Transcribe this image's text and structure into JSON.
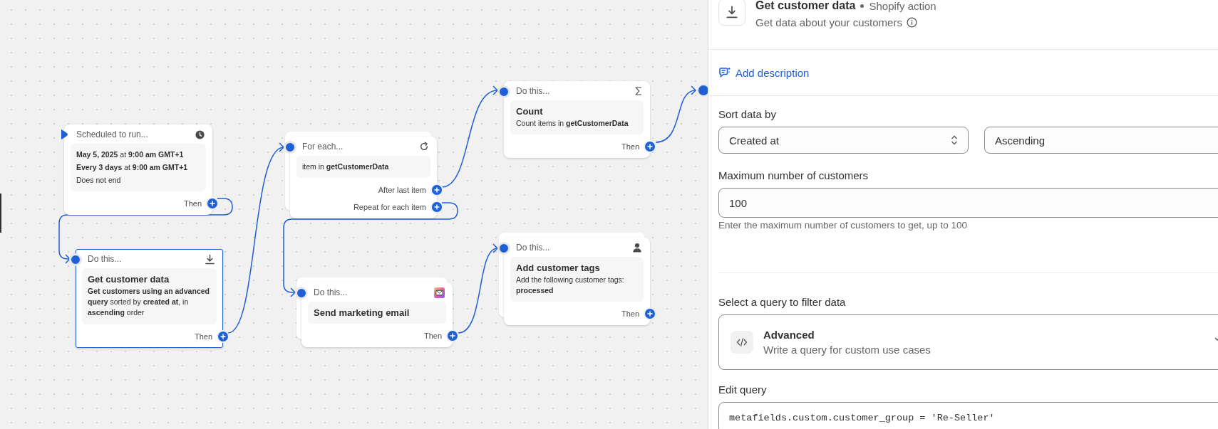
{
  "canvas": {
    "nodes": [
      {
        "kind": "trigger",
        "header": "Scheduled to run...",
        "selected": false,
        "stacked": false,
        "lines": [
          "**May 5, 2025** at **9:00 am GMT+1**",
          "**Every 3 days** at **9:00 am GMT+1**",
          "Does not end"
        ],
        "ports": [
          {
            "label": "Then"
          }
        ]
      },
      {
        "kind": "action",
        "header": "Do this...",
        "selected": true,
        "stacked": false,
        "title": "Get customer data",
        "body": "**Get customers using an advanced query** sorted by **created at**, in **ascending** order",
        "ports": [
          {
            "label": "Then"
          }
        ]
      },
      {
        "kind": "loop",
        "header": "For each...",
        "selected": false,
        "stacked": true,
        "body": "item in **getCustomerData**",
        "ports": [
          {
            "label": "After last item"
          },
          {
            "label": "Repeat for each item"
          }
        ]
      },
      {
        "kind": "action",
        "header": "Do this...",
        "selected": false,
        "stacked": true,
        "title": "Send marketing email",
        "ports": [
          {
            "label": "Then"
          }
        ]
      },
      {
        "kind": "action",
        "header": "Do this...",
        "selected": false,
        "stacked": false,
        "title": "Count",
        "body": "Count items in **getCustomerData**",
        "ports": [
          {
            "label": "Then"
          }
        ]
      },
      {
        "kind": "action",
        "header": "Do this...",
        "selected": false,
        "stacked": true,
        "title": "Add customer tags",
        "body": "Add the following customer tags: **processed**",
        "ports": [
          {
            "label": "Then"
          }
        ]
      }
    ]
  },
  "panel": {
    "title": "Get customer data",
    "source": "Shopify action",
    "description": "Get data about your customers",
    "add_description": "Add description",
    "sort": {
      "label": "Sort data by",
      "field": "Created at",
      "order": "Ascending"
    },
    "maximum": {
      "label": "Maximum number of customers",
      "value": "100",
      "help": "Enter the maximum number of customers to get, up to 100"
    },
    "query_type": {
      "label": "Select a query to filter data",
      "title": "Advanced",
      "description": "Write a query for custom use cases"
    },
    "edit_query": {
      "label": "Edit query",
      "value": "metafields.custom.customer_group = 'Re-Seller'"
    }
  }
}
